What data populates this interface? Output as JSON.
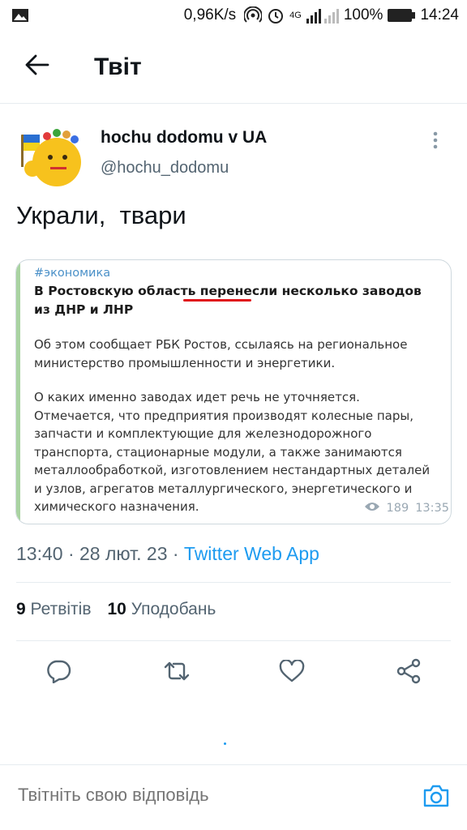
{
  "status_bar": {
    "speed": "0,96K/s",
    "network": "4G",
    "battery": "100%",
    "time": "14:24",
    "icons": [
      "image-icon",
      "hotspot-icon",
      "alarm-icon",
      "signal-icon",
      "battery-icon"
    ]
  },
  "header": {
    "title": "Твіт",
    "back_icon": "arrow-left-icon"
  },
  "tweet": {
    "author_name": "hochu dodomu v UA",
    "author_handle": "@hochu_dodomu",
    "text": "Украли,  твари",
    "media": {
      "tag": "#экономика",
      "headline": "В Ростовскую область перенесли несколько заводов из ДНР и ЛНР",
      "paragraph1": "Об этом сообщает РБК Ростов, ссылаясь на региональное министерство промышленности и энергетики.",
      "paragraph2": "О каких именно заводах идет речь не уточняется. Отмечается, что предприятия производят колесные пары, запчасти и комплектующие для железнодорожного транспорта, стационарные модули, а также занимаются металлообработкой, изготовлением нестандартных деталей и узлов, агрегатов металлургического, энергетического и химического назначения.",
      "views": "189",
      "time": "13:35"
    },
    "timestamp": "13:40 · 28 лют. 23 · ",
    "source_app": "Twitter Web App",
    "retweets_count": "9",
    "retweets_label": "Ретвітів",
    "likes_count": "10",
    "likes_label": "Уподобань"
  },
  "actions": [
    "reply-icon",
    "retweet-icon",
    "like-icon",
    "share-icon"
  ],
  "reply": {
    "placeholder": "Твітніть свою відповідь"
  },
  "colors": {
    "accent": "#1d9bf0",
    "secondary_text": "#536471",
    "underline_red": "#e0141c"
  }
}
